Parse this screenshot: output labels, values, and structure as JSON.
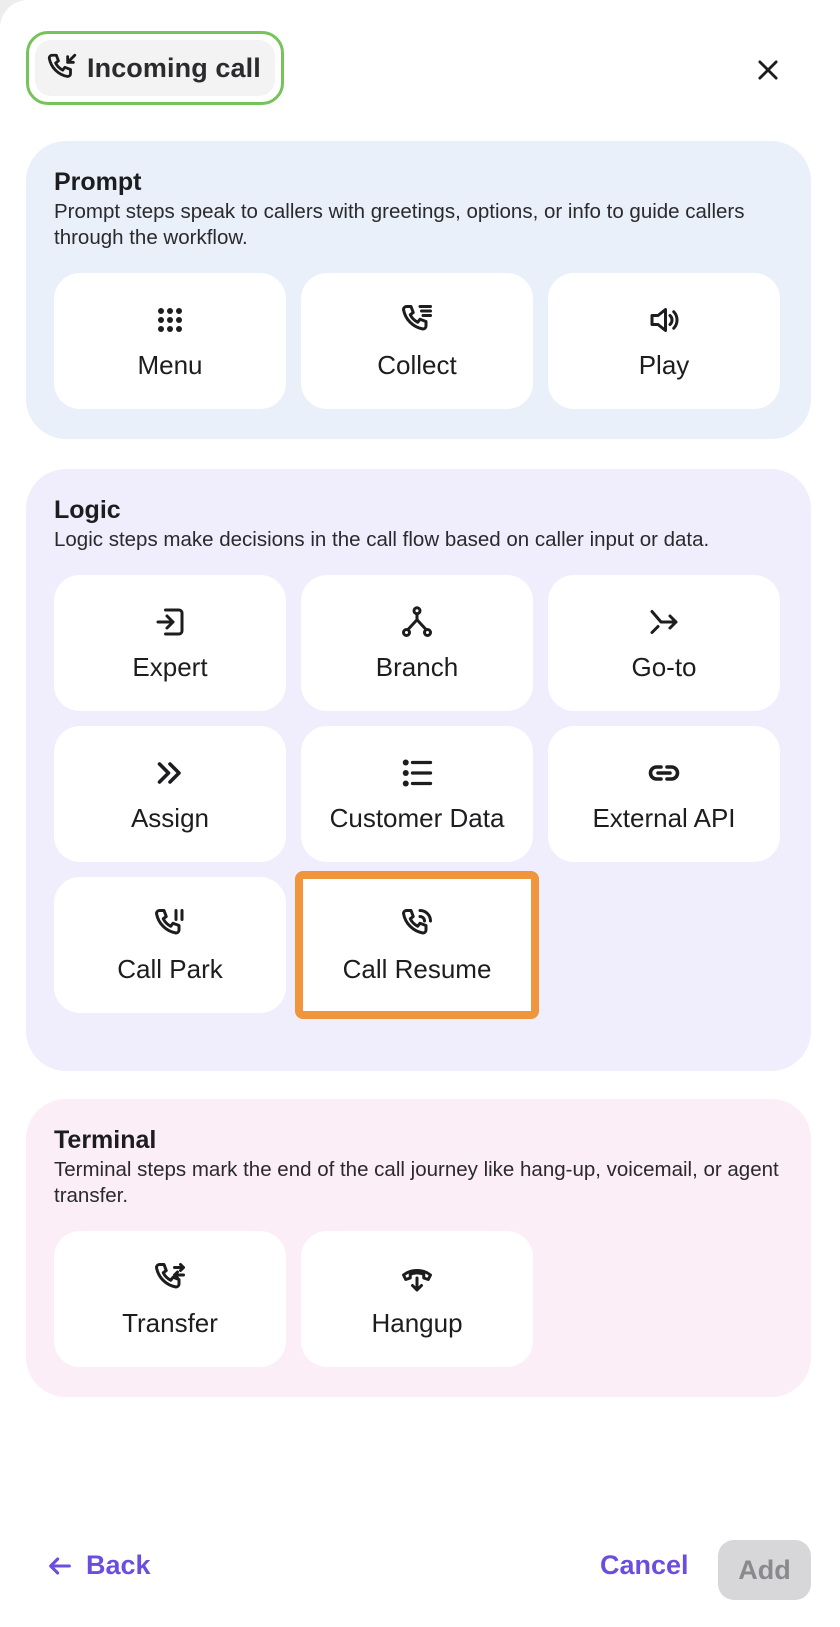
{
  "header": {
    "title": "Incoming call",
    "accent_color": "#77c35b"
  },
  "sections": {
    "prompt": {
      "title": "Prompt",
      "description": "Prompt steps speak to callers with greetings, options, or info to guide callers through the workflow.",
      "items": [
        {
          "label": "Menu",
          "icon": "grid-dots-icon"
        },
        {
          "label": "Collect",
          "icon": "phone-collect-icon"
        },
        {
          "label": "Play",
          "icon": "speaker-icon"
        }
      ]
    },
    "logic": {
      "title": "Logic",
      "description": "Logic steps make decisions in the call flow based on caller input or data.",
      "items": [
        {
          "label": "Expert",
          "icon": "login-arrow-icon"
        },
        {
          "label": "Branch",
          "icon": "branch-icon"
        },
        {
          "label": "Go-to",
          "icon": "goto-arrow-icon"
        },
        {
          "label": "Assign",
          "icon": "double-chevron-icon"
        },
        {
          "label": "Customer Data",
          "icon": "list-icon"
        },
        {
          "label": "External API",
          "icon": "link-icon"
        },
        {
          "label": "Call Park",
          "icon": "phone-pause-icon"
        },
        {
          "label": "Call Resume",
          "icon": "phone-resume-icon",
          "selected": true
        }
      ]
    },
    "terminal": {
      "title": "Terminal",
      "description": "Terminal steps mark the end of the call journey like hang-up, voicemail, or agent transfer.",
      "items": [
        {
          "label": "Transfer",
          "icon": "phone-transfer-icon"
        },
        {
          "label": "Hangup",
          "icon": "hangup-icon"
        }
      ]
    }
  },
  "footer": {
    "back_label": "Back",
    "cancel_label": "Cancel",
    "add_label": "Add",
    "link_color": "#6b4ee0",
    "selection_color": "#f0953b"
  }
}
